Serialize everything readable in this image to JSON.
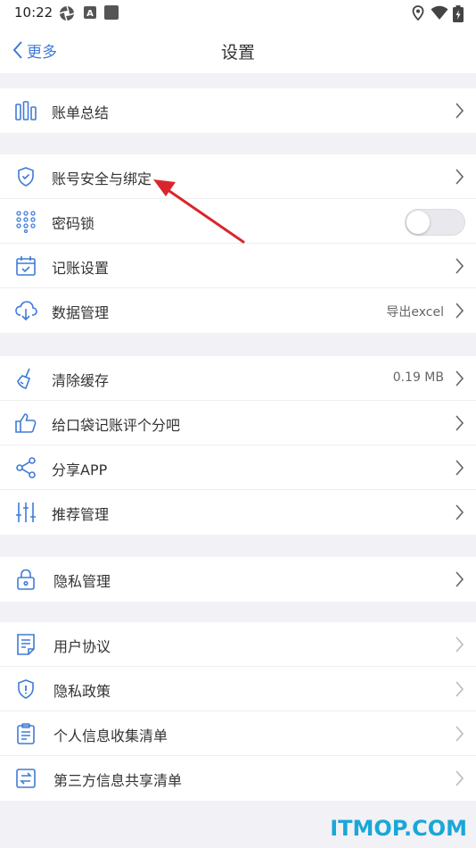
{
  "status_bar": {
    "time": "10:22"
  },
  "nav": {
    "back_label": "更多",
    "title": "设置"
  },
  "groups": [
    {
      "items": [
        {
          "label": "账单总结",
          "icon": "chart-bars-icon"
        }
      ]
    },
    {
      "items": [
        {
          "label": "账号安全与绑定",
          "icon": "shield-check-icon"
        },
        {
          "label": "密码锁",
          "icon": "keypad-dots-icon"
        },
        {
          "label": "记账设置",
          "icon": "calendar-check-icon"
        },
        {
          "label": "数据管理",
          "value": "导出excel",
          "icon": "cloud-download-icon"
        }
      ]
    },
    {
      "items": [
        {
          "label": "清除缓存",
          "value": "0.19 MB",
          "icon": "broom-icon"
        },
        {
          "label": "给口袋记账评个分吧",
          "icon": "thumbs-up-icon"
        },
        {
          "label": "分享APP",
          "icon": "share-icon"
        },
        {
          "label": "推荐管理",
          "icon": "sliders-icon"
        }
      ]
    },
    {
      "items": [
        {
          "label": "隐私管理",
          "icon": "lock-icon"
        }
      ]
    },
    {
      "items": [
        {
          "label": "用户协议",
          "icon": "document-icon"
        },
        {
          "label": "隐私政策",
          "icon": "shield-info-icon"
        },
        {
          "label": "个人信息收集清单",
          "icon": "clipboard-icon"
        },
        {
          "label": "第三方信息共享清单",
          "icon": "exchange-icon"
        }
      ]
    }
  ],
  "toggle": {
    "password_lock_on": false
  },
  "colors": {
    "accent": "#3f7bd7",
    "background": "#f2f2f6",
    "annotation_arrow": "#d9262c",
    "watermark": "#1aa7d8"
  },
  "watermark": "ITMOP.COM"
}
